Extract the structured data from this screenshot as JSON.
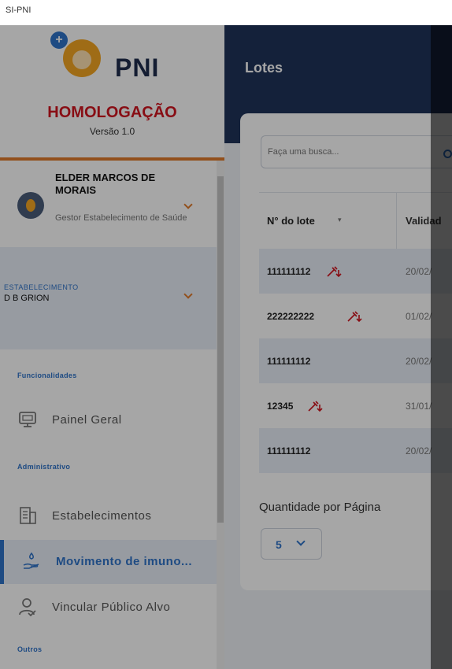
{
  "window": {
    "title": "SI-PNI"
  },
  "sidebar": {
    "logo_text": "PNI",
    "environment": "HOMOLOGAÇÃO",
    "version": "Versão 1.0",
    "user": {
      "name": "ELDER MARCOS DE MORAIS",
      "role": "Gestor Estabelecimento de Saúde"
    },
    "establishment": {
      "label": "ESTABELECIMENTO",
      "value": "D B GRION"
    },
    "sections": {
      "funcionalidades": "Funcionalidades",
      "administrativo": "Administrativo",
      "outros": "Outros"
    },
    "items": [
      {
        "label": "Painel Geral",
        "icon": "monitor-icon"
      },
      {
        "label": "Estabelecimentos",
        "icon": "building-icon"
      },
      {
        "label": "Movimento de imuno...",
        "icon": "hand-drop-icon",
        "active": true
      },
      {
        "label": "Vincular Público Alvo",
        "icon": "user-check-icon"
      }
    ]
  },
  "main": {
    "title": "Lotes",
    "search": {
      "placeholder": "Faça uma busca..."
    },
    "table": {
      "headers": {
        "lote": "N° do lote",
        "validade": "Validad"
      },
      "rows": [
        {
          "lote": "111111112",
          "validade": "20/02/",
          "flag": true
        },
        {
          "lote": "222222222",
          "validade": "01/02/",
          "flag": true
        },
        {
          "lote": "111111112",
          "validade": "20/02/",
          "flag": false
        },
        {
          "lote": "12345",
          "validade": "31/01/",
          "flag": true
        },
        {
          "lote": "111111112",
          "validade": "20/02/",
          "flag": false
        }
      ]
    },
    "pagination": {
      "label": "Quantidade por Página",
      "value": "5"
    }
  },
  "colors": {
    "navy": "#20345a",
    "accent": "#2f73c9",
    "orange": "#e07b2b",
    "red": "#d2151f"
  }
}
